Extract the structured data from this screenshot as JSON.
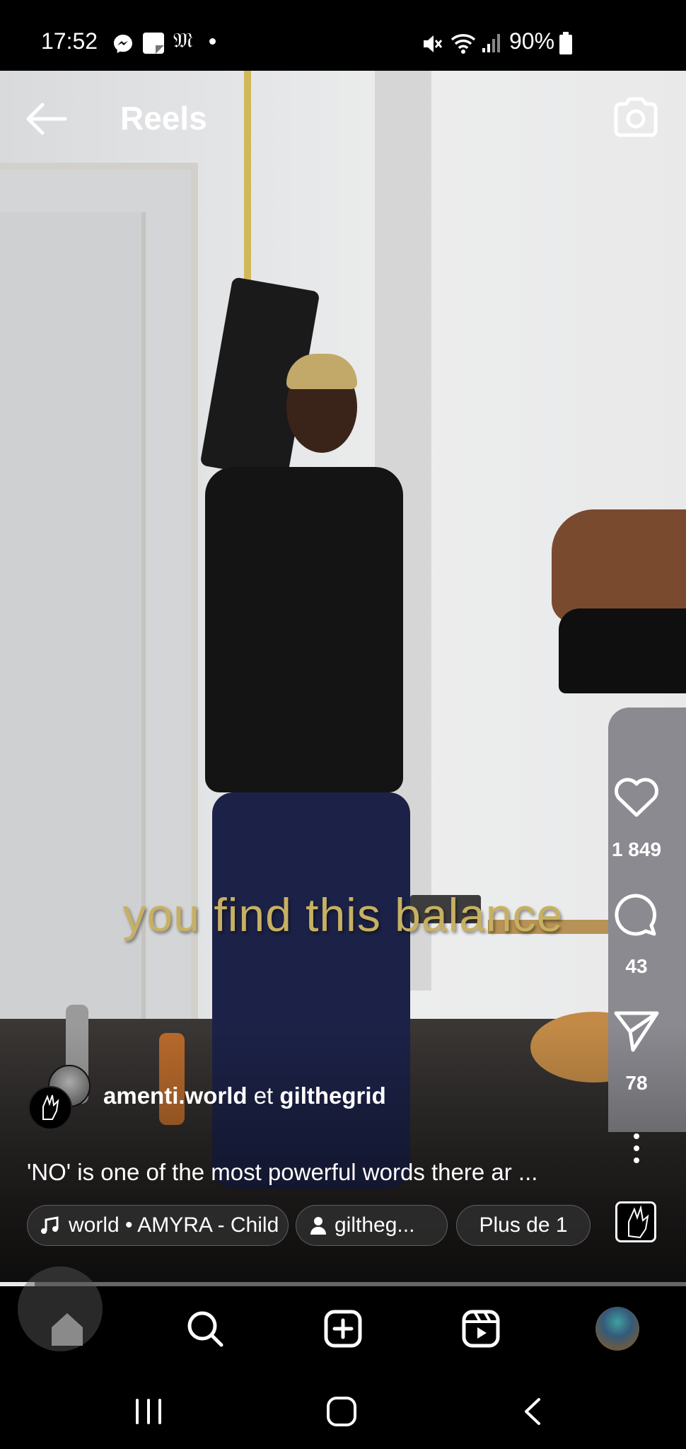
{
  "status_bar": {
    "time": "17:52",
    "battery": "90%",
    "icons": [
      "messenger-icon",
      "notes-icon",
      "gothic-m-icon",
      "dot-icon",
      "mute-icon",
      "wifi-icon",
      "signal-icon",
      "battery-icon"
    ]
  },
  "header": {
    "title": "Reels",
    "back_icon": "arrow-left-icon",
    "camera_icon": "camera-icon"
  },
  "video": {
    "subtitle": "you find this balance"
  },
  "actions": {
    "likes": "1 849",
    "comments": "43",
    "shares": "78"
  },
  "post": {
    "author1": "amenti.world",
    "joiner": "et",
    "author2": "gilthegrid",
    "caption": "'NO' is one of the most powerful words there ar ..."
  },
  "chips": {
    "audio": "world • AMYRA - Child",
    "tagged": "giltheg...",
    "more": "Plus de 1"
  },
  "playback": {
    "progress": 0.05
  },
  "bottom_nav": {
    "items": [
      "home-icon",
      "search-icon",
      "create-icon",
      "reels-icon",
      "profile-avatar"
    ]
  },
  "system_nav": {
    "items": [
      "recents-icon",
      "home-pill-icon",
      "back-chevron-icon"
    ]
  },
  "colors": {
    "subtitle": "#c8b062",
    "background": "#000000",
    "text": "#ffffff"
  }
}
